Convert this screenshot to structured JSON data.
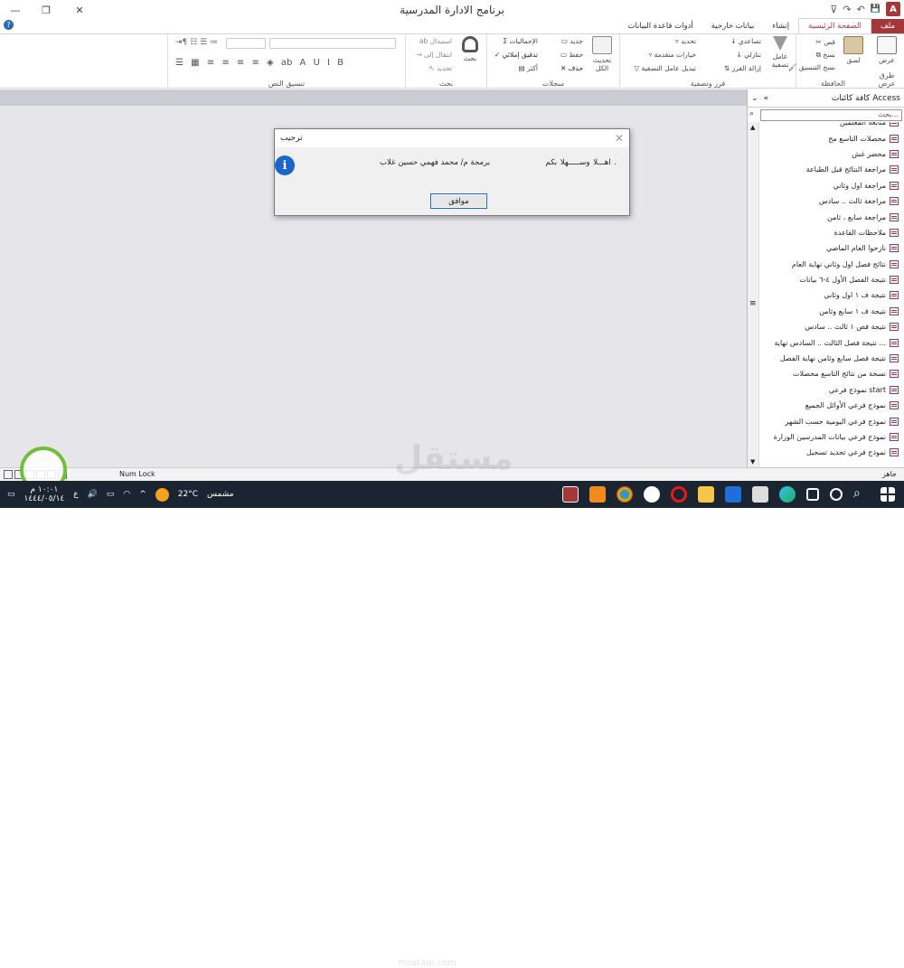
{
  "window": {
    "title": "برنامج الادارة المدرسية",
    "min": "—",
    "restore": "❐",
    "close": "✕"
  },
  "qat": {
    "app": "A",
    "save": "💾",
    "undo": "↶",
    "redo": "↷",
    "customize": "⊽"
  },
  "tabs": [
    "ملف",
    "الصفحة الرئيسية",
    "إنشاء",
    "بيانات خارجية",
    "أدوات قاعدة البيانات"
  ],
  "ribbon": {
    "views": {
      "label": "طرق عرض",
      "view": "عرض"
    },
    "clipboard": {
      "label": "الحافظة",
      "paste": "لصق",
      "cut": "قص",
      "copy": "نسخ",
      "format_painter": "نسخ التنسيق"
    },
    "sort_filter": {
      "label": "فرز وتصفية",
      "filter": "عامل تصفية",
      "ascending": "تصاعدي",
      "descending": "تنازلي",
      "remove_sort": "إزالة الفرز",
      "selection": "تحديد",
      "advanced": "خيارات متقدمة",
      "toggle": "تبديل عامل التصفية"
    },
    "records": {
      "label": "سجلات",
      "refresh": "تحديث الكل",
      "new": "جديد",
      "save": "حفظ",
      "delete": "حذف",
      "totals": "الإجماليات",
      "spelling": "تدقيق إملائي",
      "more": "أكثر"
    },
    "find": {
      "label": "بحث",
      "find": "بحث",
      "replace": "استبدال",
      "goto": "انتقال إلى",
      "select": "تحديد"
    },
    "text": {
      "label": "تنسيق النص"
    }
  },
  "nav": {
    "title": "كافة كائنات Access",
    "collapse": "«",
    "search_placeholder": "بحث...",
    "items": [
      "متابعة المعلمين",
      "محصلات التاسع مح",
      "محضر غش",
      "مراجعة النتائج قبل الطباعة",
      "مراجعة اول وثاني",
      "مراجعة ثالث .. سادس",
      "مراجعة سابع ، ثامن",
      "ملاحظات القاعدة",
      "نازحوا العام الماضي",
      "نتائج فصل اول وثاني نهاية العام",
      "نتيجة الفصل الأول ٤-٦ بيانات",
      "نتيجة ف ١ اول وثاني",
      "نتيجة ف ١ سابع وثامن",
      "نتيجة فص ١ ثالث .. سادس",
      "نتيجة فصل الثالث .. السادس نهاية ...",
      "نتيجة فصل سابع وثامن نهاية الفصل",
      "نسخة من نتائج التاسع محصلات",
      "نموذج فرعي start",
      "نموذج فرعي الأوائل الجميع",
      "نموذج فرعي اليومية حسب الشهر",
      "نموذج فرعي بيانات المدرسين الوزارة",
      "نموذج فرعي تحديد تسجيل"
    ]
  },
  "dialog": {
    "title": "ترحيب",
    "message_welcome": "اهـــلا وســـــهلا بكم .",
    "message_author": "برمجة م/ محمد فهمي حسين غلاب",
    "ok": "موافق"
  },
  "status": {
    "ready": "جاهز",
    "numlock": "Num Lock"
  },
  "taskbar": {
    "temp": "22°C",
    "weather": "مشمس",
    "time": "١٠:٠١ م",
    "date": "١٤٤٤/٠٥/١٤",
    "lang": "ع"
  },
  "watermark": {
    "text": "مستقل",
    "url": "mostaql.com"
  },
  "colors": {
    "access": "#a4373a",
    "taskbar": "#1b2532",
    "info": "#1b66c9"
  }
}
